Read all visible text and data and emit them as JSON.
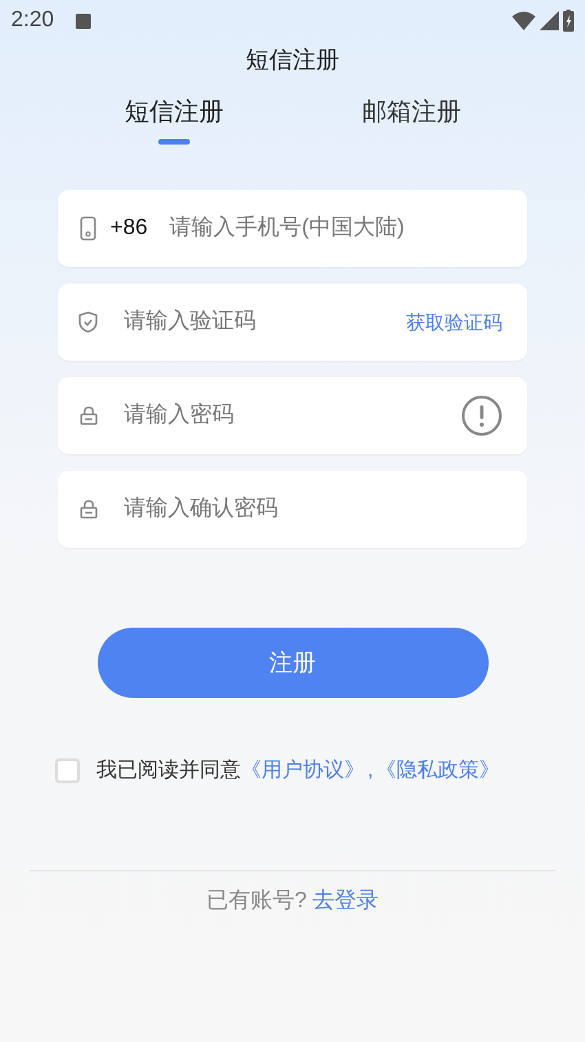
{
  "status_bar": {
    "time": "2:20"
  },
  "title": "短信注册",
  "tabs": [
    {
      "label": "短信注册",
      "selected": true
    },
    {
      "label": "邮箱注册",
      "selected": false
    }
  ],
  "fields": [
    {
      "kind": "phone",
      "prefix": "+86",
      "placeholder": "请输入手机号(中国大陆)"
    },
    {
      "kind": "code",
      "placeholder": "请输入验证码",
      "action": "获取验证码"
    },
    {
      "kind": "password",
      "placeholder": "请输入密码",
      "warning": true
    },
    {
      "kind": "confirm",
      "placeholder": "请输入确认密码"
    }
  ],
  "submit_button": "注册",
  "agreement": {
    "checked": false,
    "text": "我已阅读并同意",
    "links": [
      "《用户协议》",
      "《隐私政策》"
    ],
    "separator": ","
  },
  "login_prompt": {
    "text": "已有账号?",
    "link": "去登录"
  }
}
